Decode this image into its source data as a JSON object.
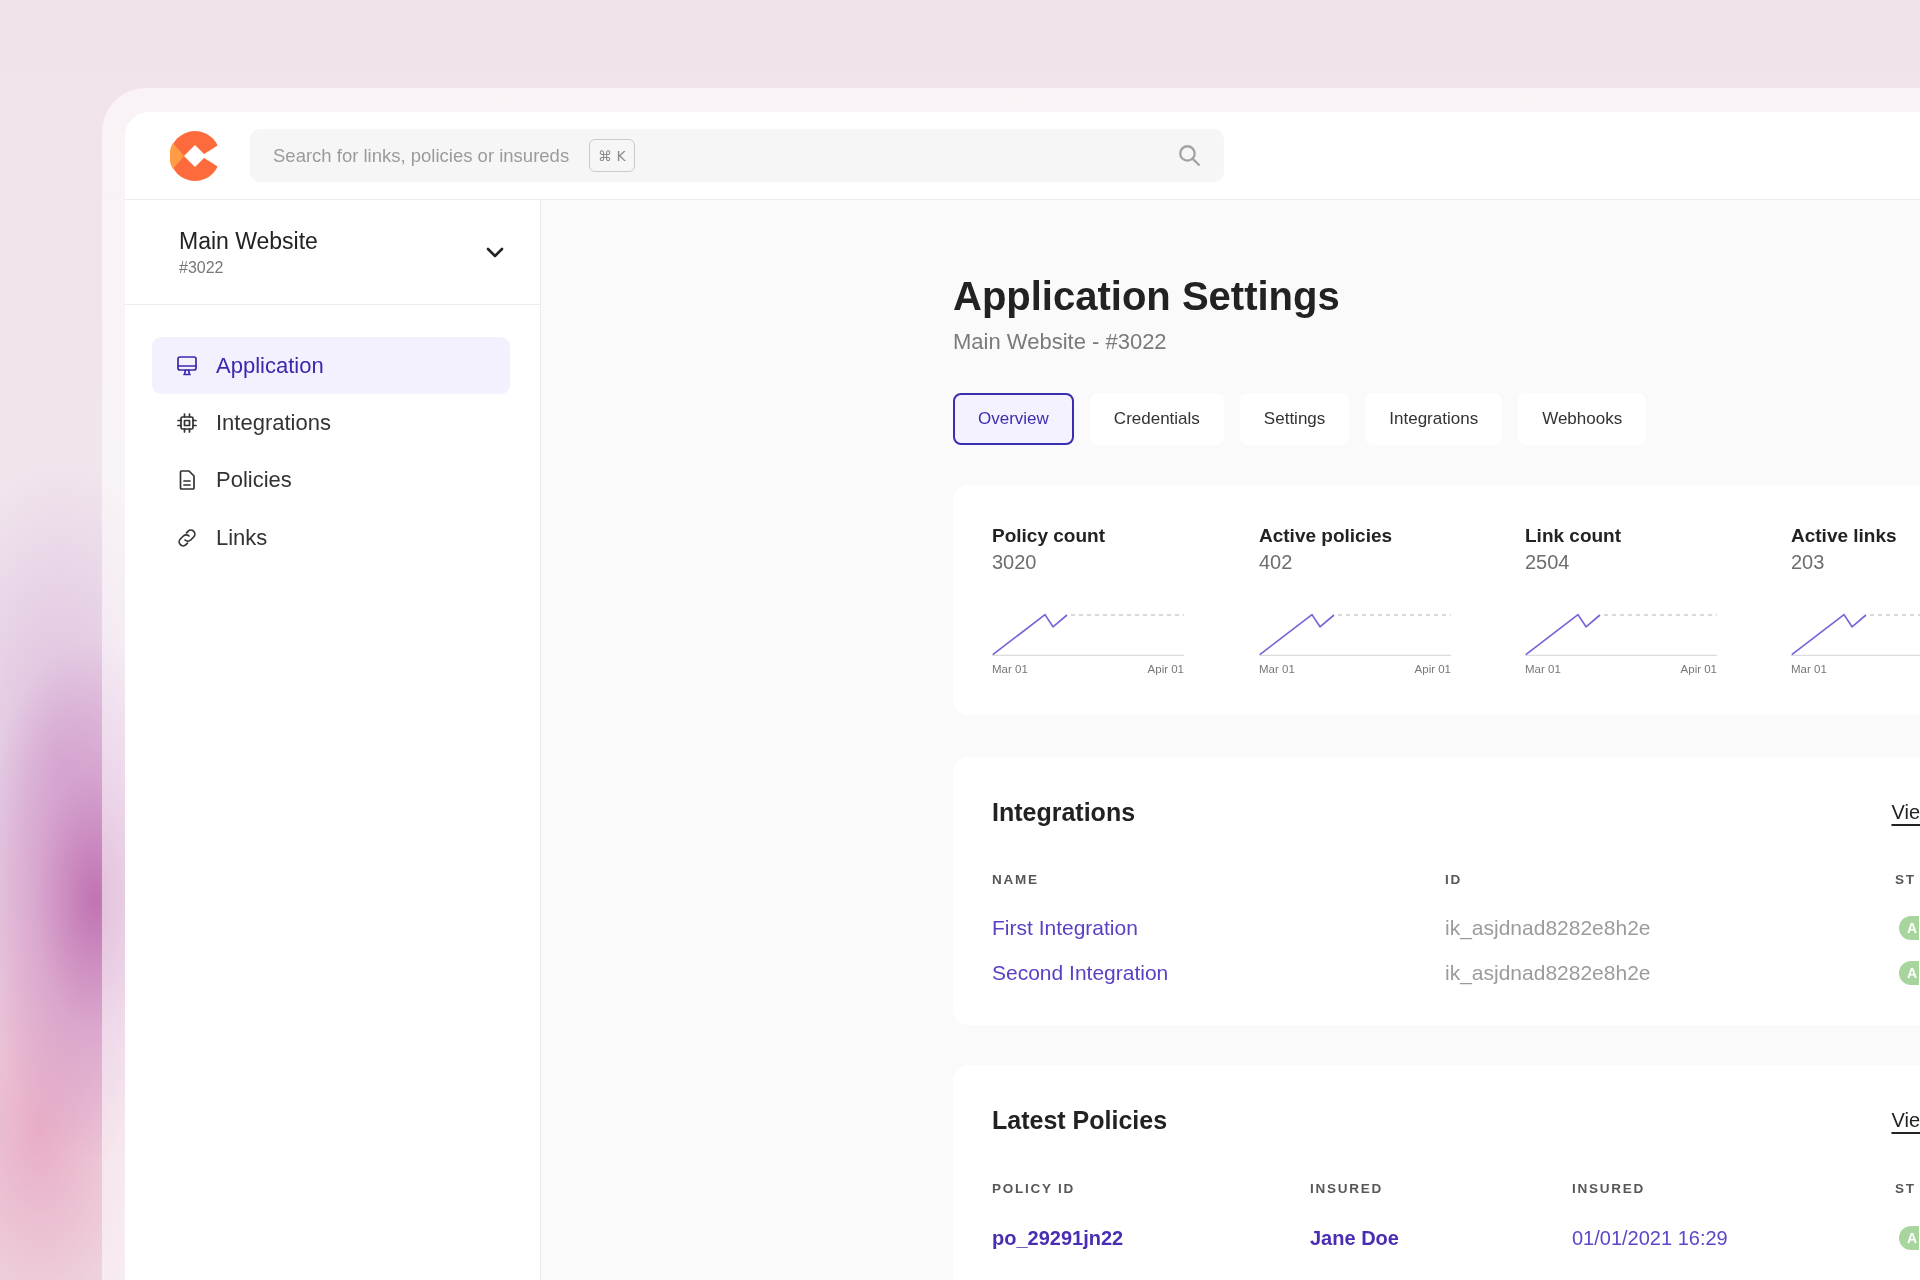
{
  "search": {
    "placeholder": "Search for links, policies or insureds",
    "shortcut": "⌘ K"
  },
  "workspace": {
    "name": "Main Website",
    "id": "#3022"
  },
  "sidebar": {
    "items": [
      {
        "label": "Application",
        "selected": true
      },
      {
        "label": "Integrations",
        "selected": false
      },
      {
        "label": "Policies",
        "selected": false
      },
      {
        "label": "Links",
        "selected": false
      }
    ]
  },
  "header": {
    "title": "Application Settings",
    "subtitle": "Main Website - #3022"
  },
  "tabs": [
    {
      "label": "Overview",
      "selected": true
    },
    {
      "label": "Credentials",
      "selected": false
    },
    {
      "label": "Settings",
      "selected": false
    },
    {
      "label": "Integrations",
      "selected": false
    },
    {
      "label": "Webhooks",
      "selected": false
    }
  ],
  "stats": [
    {
      "label": "Policy count",
      "value": "3020",
      "axis_start": "Mar 01",
      "axis_end": "Apir 01"
    },
    {
      "label": "Active policies",
      "value": "402",
      "axis_start": "Mar 01",
      "axis_end": "Apir 01"
    },
    {
      "label": "Link count",
      "value": "2504",
      "axis_start": "Mar 01",
      "axis_end": "Apir 01"
    },
    {
      "label": "Active links",
      "value": "203",
      "axis_start": "Mar 01"
    }
  ],
  "integrations": {
    "title": "Integrations",
    "link": "Vie",
    "columns": [
      "NAME",
      "ID",
      "ST"
    ],
    "rows": [
      {
        "name": "First Integration",
        "id": "ik_asjdnad8282e8h2e",
        "status": "A"
      },
      {
        "name": "Second Integration",
        "id": "ik_asjdnad8282e8h2e",
        "status": "A"
      }
    ]
  },
  "latest_policies": {
    "title": "Latest Policies",
    "link": "Vie",
    "columns": [
      "POLICY ID",
      "INSURED",
      "INSURED",
      "ST"
    ],
    "rows": [
      {
        "policy_id": "po_29291jn22",
        "insured": "Jane Doe",
        "date": "01/01/2021 16:29",
        "status": "A"
      }
    ]
  }
}
